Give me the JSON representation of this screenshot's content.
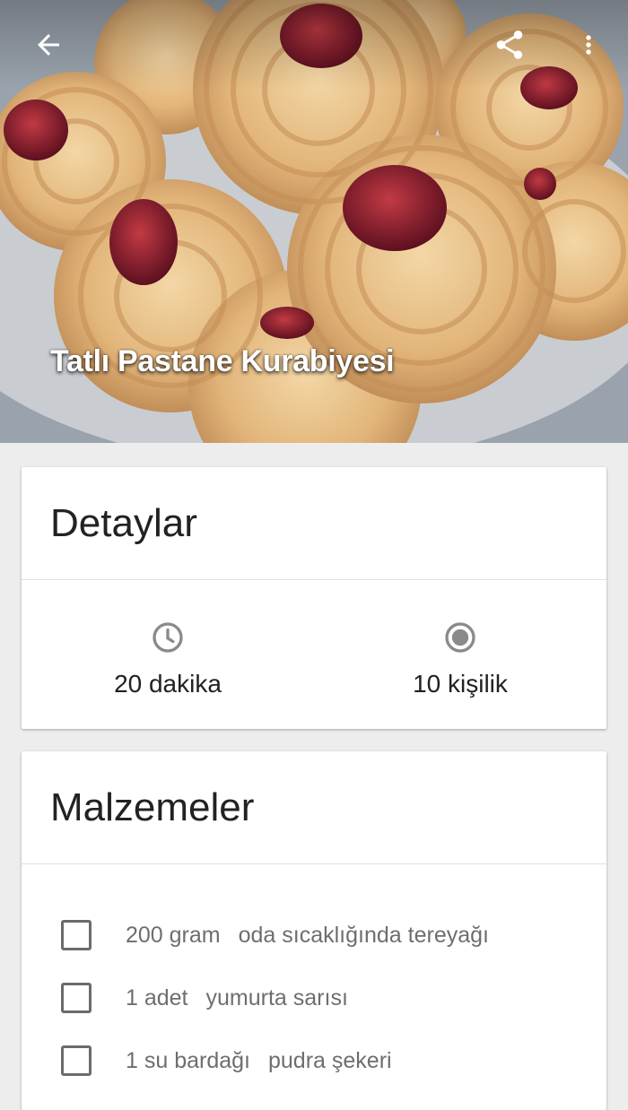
{
  "recipe": {
    "title": "Tatlı Pastane Kurabiyesi"
  },
  "toolbar": {
    "back_icon": "arrow-back-icon",
    "share_icon": "share-icon",
    "more_icon": "more-vert-icon"
  },
  "details": {
    "title": "Detaylar",
    "duration": {
      "icon": "clock-icon",
      "text": "20 dakika"
    },
    "servings": {
      "icon": "radio-circle-icon",
      "text": "10 kişilik"
    }
  },
  "ingredients": {
    "title": "Malzemeler",
    "items": [
      {
        "qty": "200 gram",
        "name": "oda sıcaklığında tereyağı",
        "checked": false
      },
      {
        "qty": "1 adet",
        "name": "yumurta sarısı",
        "checked": false
      },
      {
        "qty": "1 su bardağı",
        "name": "pudra şekeri",
        "checked": false
      }
    ]
  },
  "colors": {
    "background": "#ededed",
    "card": "#ffffff",
    "icon_gray": "#8a8a8a",
    "text_primary": "#212121",
    "text_secondary": "#6e6e6e"
  }
}
